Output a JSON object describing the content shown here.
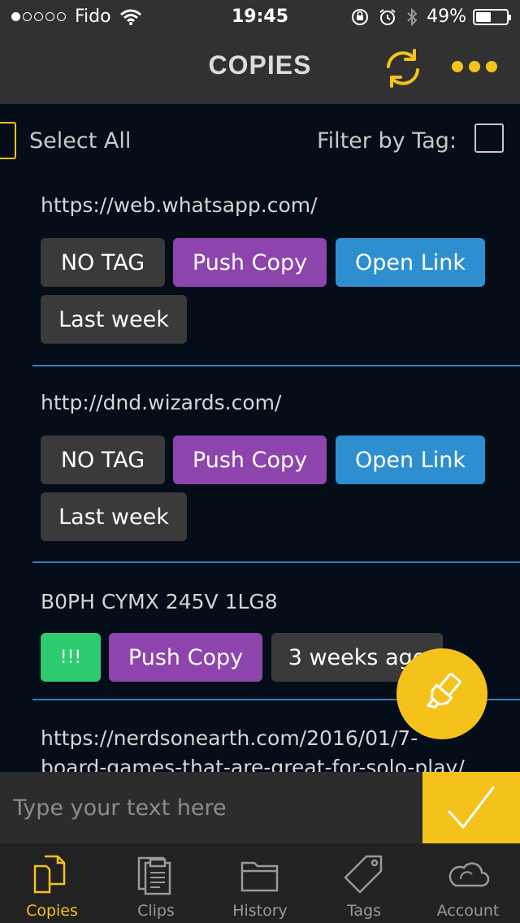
{
  "status": {
    "carrier": "Fido",
    "time": "19:45",
    "battery": "49%"
  },
  "header": {
    "title": "COPIES"
  },
  "toolbar": {
    "select_all": "Select All",
    "filter_by_tag": "Filter by Tag:"
  },
  "items": [
    {
      "text": "https://web.whatsapp.com/",
      "tag": "NO TAG",
      "push": "Push Copy",
      "open": "Open Link",
      "time": "Last week"
    },
    {
      "text": "http://dnd.wizards.com/",
      "tag": "NO TAG",
      "push": "Push Copy",
      "open": "Open Link",
      "time": "Last week"
    },
    {
      "text": "B0PH CYMX 245V 1LG8",
      "tag": "!!!",
      "push": "Push Copy",
      "time": "3 weeks ago"
    },
    {
      "text": "https://nerdsonearth.com/2016/01/7-",
      "text2": "board-games-that-are-great-for-solo-play/"
    }
  ],
  "input": {
    "placeholder": "Type your text here"
  },
  "tabs": [
    {
      "label": "Copies",
      "icon": "copies-icon",
      "active": true
    },
    {
      "label": "Clips",
      "icon": "clips-icon"
    },
    {
      "label": "History",
      "icon": "folder-icon"
    },
    {
      "label": "Tags",
      "icon": "tag-icon"
    },
    {
      "label": "Account",
      "icon": "cloud-icon"
    }
  ],
  "colors": {
    "accent": "#f5c21b",
    "purple": "#8e44ad",
    "blue": "#2e8fd0",
    "green": "#2ecc71",
    "divider": "#3a7db8"
  }
}
